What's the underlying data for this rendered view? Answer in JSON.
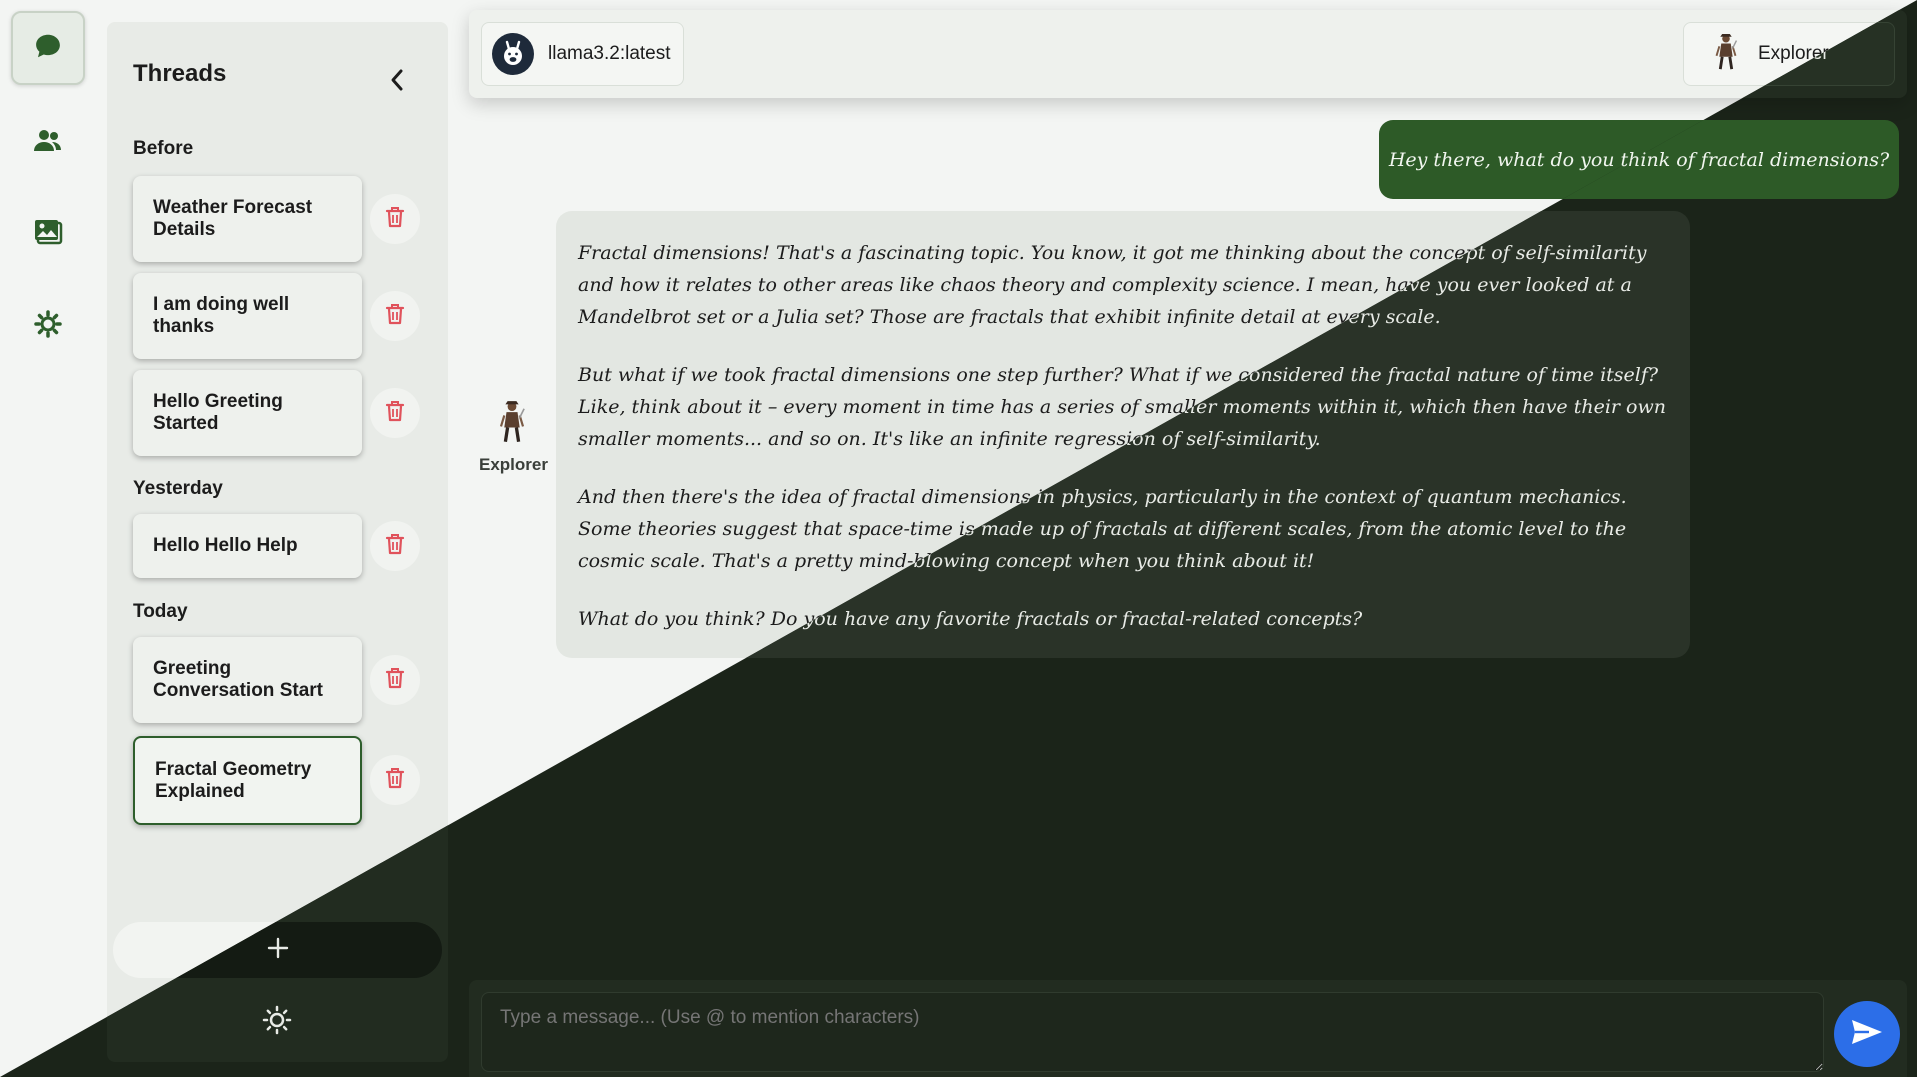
{
  "sidebar": {
    "icons": [
      "chat-icon",
      "users-icon",
      "image-icon",
      "settings-icon"
    ]
  },
  "threads": {
    "title": "Threads",
    "groups": [
      {
        "label": "Before",
        "items": [
          "Weather Forecast Details",
          "I am doing well thanks",
          "Hello Greeting Started"
        ]
      },
      {
        "label": "Yesterday",
        "items": [
          "Hello Hello Help"
        ]
      },
      {
        "label": "Today",
        "items": [
          "Greeting Conversation Start",
          "Fractal Geometry Explained"
        ]
      }
    ],
    "active": "Fractal Geometry Explained"
  },
  "header": {
    "model": "llama3.2:latest",
    "character": "Explorer"
  },
  "chat": {
    "user_message": "Hey there, what do you think of fractal dimensions?",
    "bot_name": "Explorer",
    "bot_paragraphs": [
      "Fractal dimensions! That's a fascinating topic. You know, it got me thinking about the concept of self-similarity and how it relates to other areas like chaos theory and complexity science. I mean, have you ever looked at a Mandelbrot set or a Julia set? Those are fractals that exhibit infinite detail at every scale.",
      "But what if we took fractal dimensions one step further? What if we considered the fractal nature of time itself? Like, think about it – every moment in time has a series of smaller moments within it, which then have their own smaller moments... and so on. It's like an infinite regression of self-similarity.",
      "And then there's the idea of fractal dimensions in physics, particularly in the context of quantum mechanics. Some theories suggest that space-time is made up of fractals at different scales, from the atomic level to the cosmic scale. That's a pretty mind-blowing concept when you think about it!",
      "What do you think? Do you have any favorite fractals or fractal-related concepts?"
    ]
  },
  "composer": {
    "placeholder": "Type a message... (Use @ to mention characters)"
  },
  "colors": {
    "accent": "#2d5a27",
    "send": "#2c6ee8",
    "delete": "#e0525b",
    "dark_bg": "#1b2419"
  }
}
